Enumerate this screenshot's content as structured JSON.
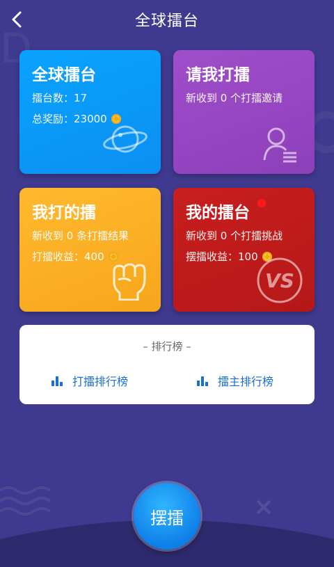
{
  "header": {
    "title": "全球擂台"
  },
  "cards": {
    "global": {
      "title": "全球擂台",
      "line1": "擂台数：17",
      "line2": "总奖励：23000"
    },
    "invite": {
      "title": "请我打擂",
      "line1": "新收到 0 个打擂邀请"
    },
    "my_challenges": {
      "title": "我打的擂",
      "line1": "新收到 0 条打擂结果",
      "line2": "打擂收益：400"
    },
    "my_arena": {
      "title": "我的擂台",
      "line1": "新收到 0 个打擂挑战",
      "line2": "摆擂收益：100"
    }
  },
  "ranking": {
    "title": "– 排行榜 –",
    "challenger_rank": "打擂排行榜",
    "host_rank": "擂主排行榜"
  },
  "fab": {
    "label": "摆擂"
  },
  "colors": {
    "background": "#3f3a8f",
    "card_blue": "#0aa3ff",
    "card_purple": "#a04ec9",
    "card_yellow": "#ffb92e",
    "card_red": "#c81e1e",
    "link_blue": "#1a6fd6"
  },
  "icons": [
    "back-arrow-icon",
    "planet-icon",
    "user-list-icon",
    "fist-icon",
    "vs-icon",
    "coin-icon",
    "bar-chart-icon"
  ]
}
